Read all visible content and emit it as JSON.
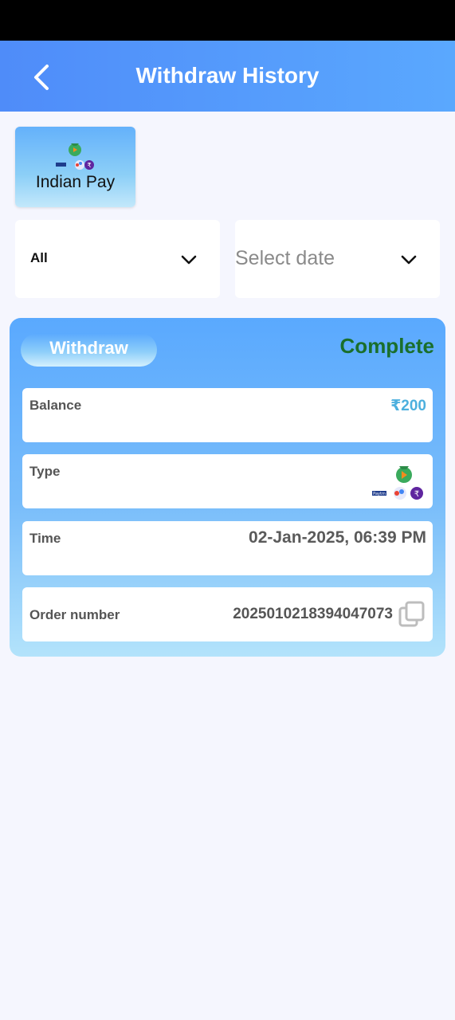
{
  "header": {
    "title": "Withdraw History",
    "back_icon": "back-arrow-icon"
  },
  "payment_tab": {
    "label": "Indian Pay",
    "icon": "upi-payment-icons"
  },
  "filters": {
    "type_value": "All",
    "date_placeholder": "Select date",
    "chevron_icon": "chevron-down-icon"
  },
  "record": {
    "kind": "Withdraw",
    "status": "Complete",
    "fields": [
      {
        "label": "Balance",
        "value": "₹200"
      },
      {
        "label": "Type",
        "value_icon": "upi-payment-icons"
      },
      {
        "label": "Time",
        "value": "02-Jan-2025, 06:39 PM"
      },
      {
        "label": "Order number",
        "value": "2025010218394047073"
      }
    ],
    "copy_icon": "copy-icon"
  },
  "colors": {
    "header_start": "#4f8cf9",
    "header_end": "#5aa8fe",
    "status_complete": "#1a6f2c",
    "balance_value": "#4db0de",
    "page_bg": "#f5f6fe"
  }
}
